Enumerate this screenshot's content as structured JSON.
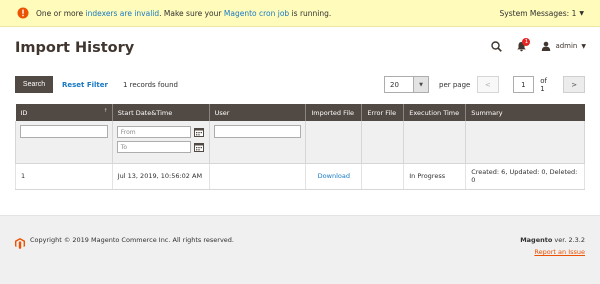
{
  "system_bar": {
    "message_prefix": "One or more ",
    "indexers_link": "indexers are invalid",
    "message_middle": ". Make sure your ",
    "cron_link": "Magento cron job",
    "message_suffix": " is running.",
    "system_messages_label": "System Messages: 1",
    "warning_color": "#eb5202"
  },
  "header": {
    "title": "Import History",
    "notification_count": "1",
    "user_label": "admin"
  },
  "toolbar": {
    "search_label": "Search",
    "reset_filter_label": "Reset Filter",
    "records_found": "1 records found",
    "per_page_value": "20",
    "per_page_label": "per page",
    "current_page": "1",
    "of_label": "of 1"
  },
  "grid": {
    "columns": [
      "ID",
      "Start Date&Time",
      "User",
      "Imported File",
      "Error File",
      "Execution Time",
      "Summary"
    ],
    "filters": {
      "date_from_placeholder": "From",
      "date_to_placeholder": "To"
    },
    "rows": [
      {
        "id": "1",
        "start": "Jul 13, 2019, 10:56:02 AM",
        "user": "",
        "imported_file": "Download",
        "error_file": "",
        "execution_time": "In Progress",
        "summary": "Created: 6, Updated: 0, Deleted: 0"
      }
    ]
  },
  "footer": {
    "copyright": "Copyright © 2019 Magento Commerce Inc. All rights reserved.",
    "brand": "Magento",
    "version": " ver. 2.3.2",
    "report_link": "Report an Issue"
  },
  "colors": {
    "header_bg": "#514943",
    "link": "#1979c3",
    "accent": "#eb5202",
    "message_bg": "#fffbbb"
  }
}
